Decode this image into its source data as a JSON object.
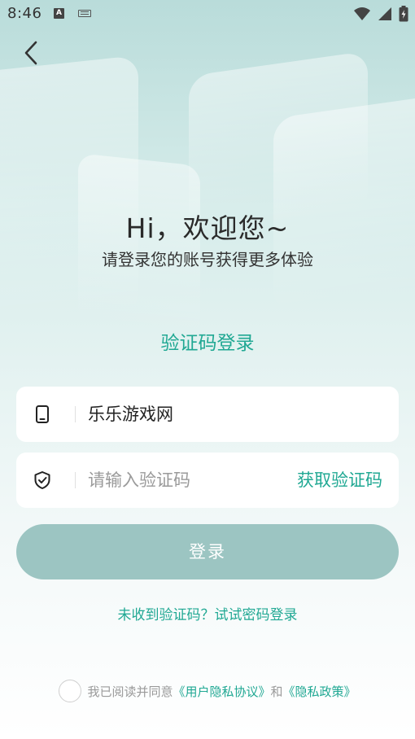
{
  "status_bar": {
    "time": "8:46",
    "a_icon_label": "A",
    "icons": [
      "a-notification-icon",
      "keyboard-icon",
      "wifi-icon",
      "signal-icon",
      "battery-charging-icon"
    ]
  },
  "nav": {
    "back_icon": "chevron-left-icon"
  },
  "greeting": {
    "title": "Hi，欢迎您~",
    "subtitle": "请登录您的账号获得更多体验"
  },
  "login_mode": {
    "title": "验证码登录"
  },
  "form": {
    "phone": {
      "icon": "phone-icon",
      "value": "乐乐游戏网"
    },
    "code": {
      "icon": "shield-check-icon",
      "placeholder": "请输入验证码",
      "value": "",
      "get_code_label": "获取验证码"
    },
    "login_label": "登录"
  },
  "alt_login": {
    "text": "未收到验证码？试试密码登录"
  },
  "agreement": {
    "checked": false,
    "prefix": "我已阅读并同意",
    "user_agreement": "《用户隐私协议》",
    "conjunction": "和",
    "privacy_policy": "《隐私政策》"
  },
  "colors": {
    "accent": "#20a893",
    "login_button": "#9cc5c2",
    "background_top": "#b9dcda",
    "background_bottom": "#ffffff"
  }
}
